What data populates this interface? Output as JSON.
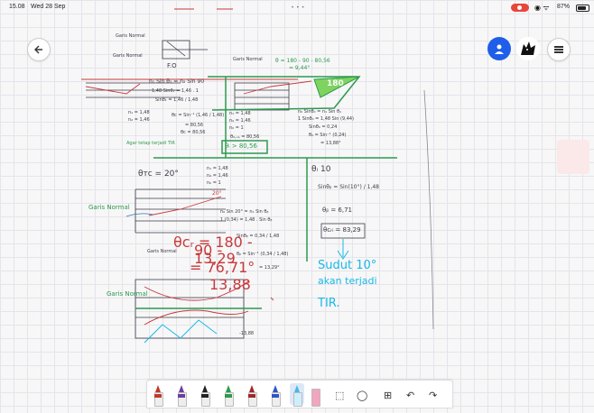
{
  "status_bar": {
    "time": "15.08",
    "date": "Wed 28 Sep",
    "battery": "87%"
  },
  "header": {
    "back_button": "back",
    "profile_button": "user-menu",
    "menu_button": "menu"
  },
  "notes": {
    "top_left": [
      "Garis Normal",
      "Garis Normal"
    ],
    "fo": "F.O",
    "f1": "Garis Normal",
    "sin_eq": "n₁ Sin θ₁ = n₂ Sin 90",
    "line2": "1,48 Sinθ₁ = 1,46 . 1",
    "line3": "Sinθ₁ = 1,46 / 1,48",
    "n_values": [
      "n₁ = 1,48",
      "n₂ = 1,46"
    ],
    "theta_c_line": "θᴄ = Sin⁻¹ (1,46 / 1,48)",
    "theta_c_val": "= 80,56",
    "theta_c_box": "θᴄ = 80,56",
    "agar_label": "Agar tetap terjadi TIR",
    "box_ans": "θᵢ > 80,56",
    "right_top": "θ = 180 - 90 - 80,56",
    "right_top2": "= 9,44°",
    "box180": "180",
    "mid_n": [
      "n₁ = 1,48",
      "n₂ = 1,46",
      "n₀ = 1"
    ],
    "right_mid": [
      "n₀ Sinθ₀ = n₁ Sin θ₁",
      "1 Sinθ₀ = 1,48 Sin (9,44)",
      "Sinθ₀ = 0,24",
      "θ₀ = Sin⁻¹ (0,24)",
      "= 13,88°"
    ],
    "theta_na": "θ₀,ₙₐ = 80,56",
    "theta_tc": "θᴛᴄ = 20°",
    "n_mid": [
      "n₁ = 1,48",
      "n₂ = 1,46",
      "n₀ = 1"
    ],
    "theta10": "θᵢ 10",
    "sin_theta_b": "Sinθᵦ = Sin(10°) / 1,48",
    "theta_b": "θᵦ = 6,71",
    "theta_cri": "θᴄᵣᵢ = 83,29",
    "sudut": [
      "Sudut 10°",
      "akan terjadi",
      "TIR."
    ],
    "garis_normal": "Garis Normal",
    "angle20": "20°",
    "snell2": [
      "n₀ Sin 20° = n₁ Sin θᵦ",
      "1 (0,34) = 1,48 . Sin θᵦ",
      "Sinθᵦ = 0,34 / 1,48",
      "θᵦ = Sin⁻¹ (0,34 / 1,48)",
      "= 13,29°"
    ],
    "theta_cr": [
      "θᴄᵣ = 180 -",
      "90 -",
      "13,29",
      "= 76,71°"
    ],
    "garis2": "Garis Normal",
    "garis3": "Garis Normal",
    "val1388": "13,88",
    "val1388b": "-13,88"
  },
  "toolbar": {
    "pens": [
      {
        "name": "pen-red",
        "color": "#c0392b"
      },
      {
        "name": "pen-purple",
        "color": "#6b3fa0"
      },
      {
        "name": "pen-black",
        "color": "#222222"
      },
      {
        "name": "pen-green",
        "color": "#2c9a4e"
      },
      {
        "name": "pen-dark-red",
        "color": "#a02828"
      },
      {
        "name": "pen-blue",
        "color": "#2d56c8"
      }
    ],
    "highlighter_color": "#45b8e8",
    "eraser_color": "#f2a5c0"
  },
  "colors": {
    "accent_blue": "#1f5ee8",
    "ink_green": "#2c9a4e",
    "ink_cyan": "#18b8e8",
    "ink_red": "#c83a3a"
  }
}
